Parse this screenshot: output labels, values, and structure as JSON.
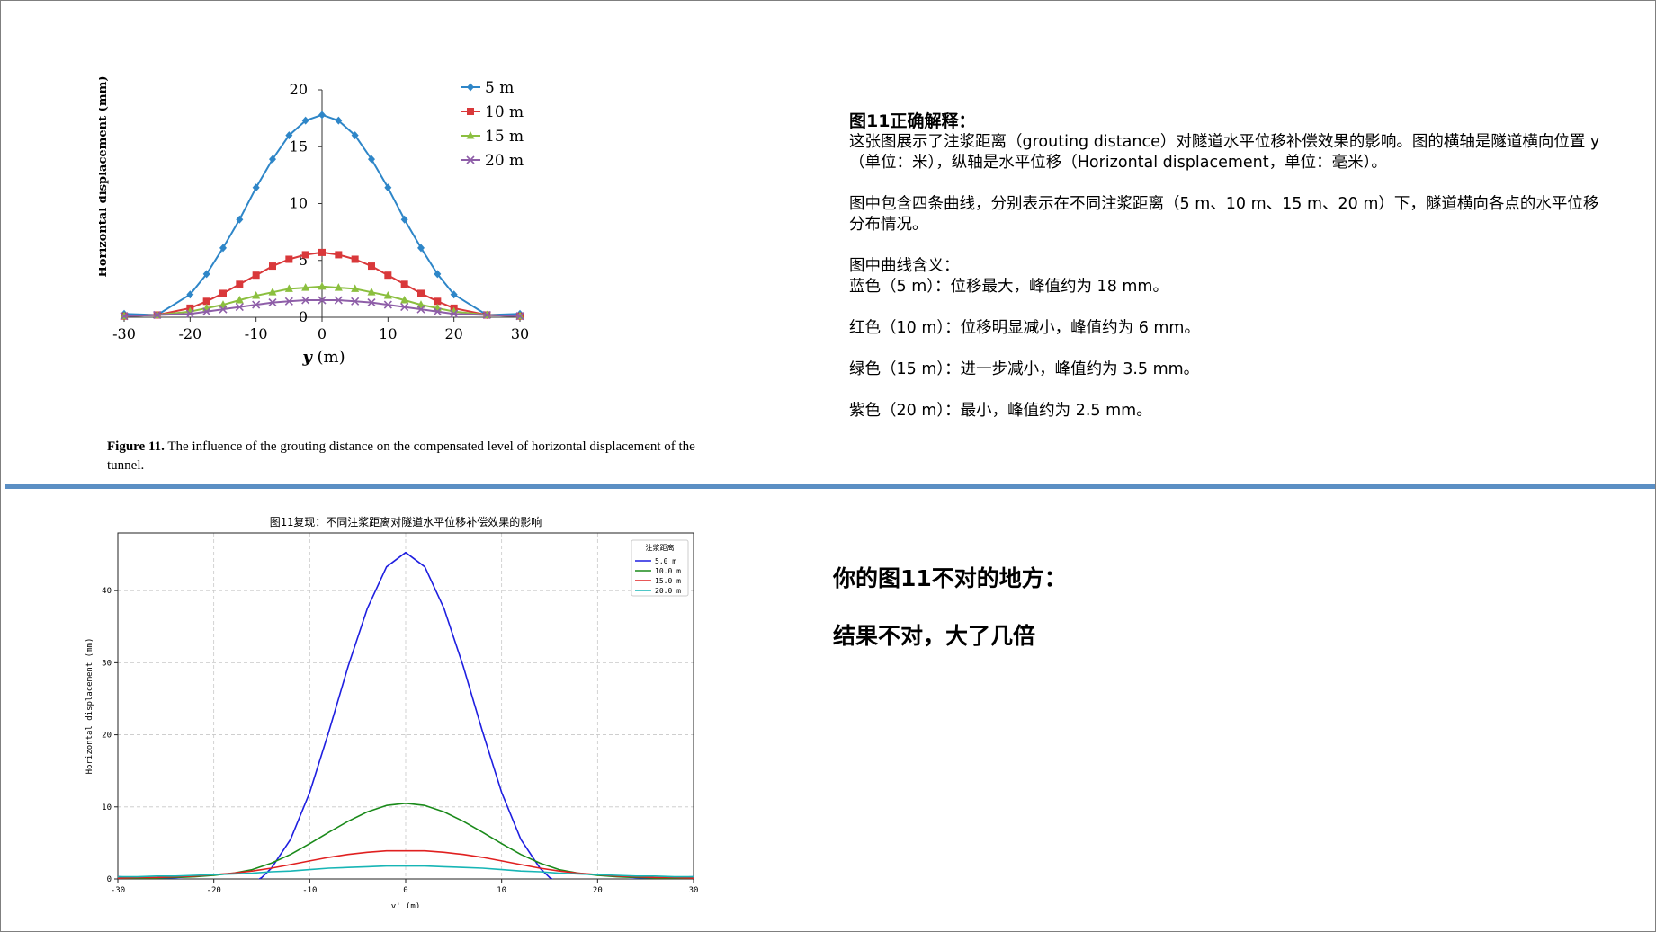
{
  "chart_data": [
    {
      "type": "line",
      "title": "",
      "xlabel": "y (m)",
      "ylabel": "Horizontal displacement (mm)",
      "xlim": [
        -30,
        30
      ],
      "ylim": [
        0,
        20
      ],
      "xticks": [
        -30,
        -20,
        -10,
        0,
        10,
        20,
        30
      ],
      "yticks": [
        0,
        5,
        10,
        15,
        20
      ],
      "grid": false,
      "legend_position": "top-right",
      "series": [
        {
          "name": "5 m",
          "color": "#2e86c8",
          "marker": "diamond",
          "x": [
            -30,
            -25,
            -20,
            -17.5,
            -15,
            -12.5,
            -10,
            -7.5,
            -5,
            -2.5,
            0,
            2.5,
            5,
            7.5,
            10,
            12.5,
            15,
            17.5,
            20,
            25,
            30
          ],
          "y": [
            0.3,
            0.2,
            2.0,
            3.8,
            6.1,
            8.6,
            11.4,
            13.9,
            16.0,
            17.3,
            17.8,
            17.3,
            16.0,
            13.9,
            11.4,
            8.6,
            6.1,
            3.8,
            2.0,
            0.2,
            0.3
          ]
        },
        {
          "name": "10 m",
          "color": "#d9383a",
          "marker": "square",
          "x": [
            -30,
            -25,
            -20,
            -17.5,
            -15,
            -12.5,
            -10,
            -7.5,
            -5,
            -2.5,
            0,
            2.5,
            5,
            7.5,
            10,
            12.5,
            15,
            17.5,
            20,
            25,
            30
          ],
          "y": [
            0.1,
            0.2,
            0.8,
            1.4,
            2.1,
            2.9,
            3.7,
            4.5,
            5.1,
            5.5,
            5.7,
            5.5,
            5.1,
            4.5,
            3.7,
            2.9,
            2.1,
            1.4,
            0.8,
            0.2,
            0.1
          ]
        },
        {
          "name": "15 m",
          "color": "#8bbf3f",
          "marker": "triangle",
          "x": [
            -30,
            -25,
            -20,
            -17.5,
            -15,
            -12.5,
            -10,
            -7.5,
            -5,
            -2.5,
            0,
            2.5,
            5,
            7.5,
            10,
            12.5,
            15,
            17.5,
            20,
            25,
            30
          ],
          "y": [
            0.1,
            0.2,
            0.5,
            0.8,
            1.1,
            1.5,
            1.9,
            2.2,
            2.5,
            2.6,
            2.7,
            2.6,
            2.5,
            2.2,
            1.9,
            1.5,
            1.1,
            0.8,
            0.5,
            0.2,
            0.1
          ]
        },
        {
          "name": "20 m",
          "color": "#8e5ea8",
          "marker": "x",
          "x": [
            -30,
            -25,
            -20,
            -17.5,
            -15,
            -12.5,
            -10,
            -7.5,
            -5,
            -2.5,
            0,
            2.5,
            5,
            7.5,
            10,
            12.5,
            15,
            17.5,
            20,
            25,
            30
          ],
          "y": [
            0.1,
            0.2,
            0.3,
            0.5,
            0.7,
            0.9,
            1.1,
            1.3,
            1.4,
            1.5,
            1.5,
            1.5,
            1.4,
            1.3,
            1.1,
            0.9,
            0.7,
            0.5,
            0.3,
            0.2,
            0.1
          ]
        }
      ]
    },
    {
      "type": "line",
      "title": "图11复现：不同注浆距离对隧道水平位移补偿效果的影响",
      "xlabel": "y' (m)",
      "ylabel": "Horizontal displacement (mm)",
      "xlim": [
        -30,
        30
      ],
      "ylim": [
        0,
        48
      ],
      "xticks": [
        -30,
        -20,
        -10,
        0,
        10,
        20,
        30
      ],
      "yticks": [
        0,
        10,
        20,
        30,
        40
      ],
      "grid": true,
      "legend_title": "注浆距离",
      "legend_position": "top-right",
      "series": [
        {
          "name": "5.0 m",
          "color": "#1f1fe0",
          "x": [
            -30,
            -28,
            -26,
            -24,
            -22,
            -20,
            -18,
            -16,
            -15,
            -14,
            -12,
            -10,
            -8,
            -6,
            -4,
            -2,
            0,
            2,
            4,
            6,
            8,
            10,
            12,
            14,
            15,
            16,
            18,
            20,
            22,
            24,
            26,
            28,
            30
          ],
          "y": [
            0.3,
            0.2,
            0.1,
            0,
            -0.2,
            -0.6,
            -1.0,
            -0.6,
            0.2,
            1.5,
            5.5,
            12.0,
            20.5,
            29.5,
            37.5,
            43.3,
            45.3,
            43.3,
            37.5,
            29.5,
            20.5,
            12.0,
            5.5,
            1.5,
            0.2,
            -0.6,
            -1.0,
            -0.6,
            -0.2,
            0,
            0.1,
            0.2,
            0.3
          ]
        },
        {
          "name": "10.0 m",
          "color": "#1a8a1a",
          "x": [
            -30,
            -28,
            -26,
            -24,
            -22,
            -20,
            -18,
            -16,
            -14,
            -12,
            -10,
            -8,
            -6,
            -4,
            -2,
            0,
            2,
            4,
            6,
            8,
            10,
            12,
            14,
            16,
            18,
            20,
            22,
            24,
            26,
            28,
            30
          ],
          "y": [
            0.1,
            0.1,
            0.1,
            0.2,
            0.3,
            0.5,
            0.8,
            1.3,
            2.2,
            3.4,
            4.9,
            6.5,
            8.0,
            9.3,
            10.2,
            10.5,
            10.2,
            9.3,
            8.0,
            6.5,
            4.9,
            3.4,
            2.2,
            1.3,
            0.8,
            0.5,
            0.3,
            0.2,
            0.1,
            0.1,
            0.1
          ]
        },
        {
          "name": "15.0 m",
          "color": "#e02020",
          "x": [
            -30,
            -28,
            -26,
            -24,
            -22,
            -20,
            -18,
            -16,
            -14,
            -12,
            -10,
            -8,
            -6,
            -4,
            -2,
            0,
            2,
            4,
            6,
            8,
            10,
            12,
            14,
            16,
            18,
            20,
            22,
            24,
            26,
            28,
            30
          ],
          "y": [
            0.1,
            0.2,
            0.2,
            0.3,
            0.4,
            0.6,
            0.8,
            1.1,
            1.5,
            2.0,
            2.5,
            3.0,
            3.4,
            3.7,
            3.9,
            3.9,
            3.9,
            3.7,
            3.4,
            3.0,
            2.5,
            2.0,
            1.5,
            1.1,
            0.8,
            0.6,
            0.4,
            0.3,
            0.2,
            0.2,
            0.1
          ]
        },
        {
          "name": "20.0 m",
          "color": "#17b5b5",
          "x": [
            -30,
            -28,
            -26,
            -24,
            -22,
            -20,
            -18,
            -16,
            -14,
            -12,
            -10,
            -8,
            -6,
            -4,
            -2,
            0,
            2,
            4,
            6,
            8,
            10,
            12,
            14,
            16,
            18,
            20,
            22,
            24,
            26,
            28,
            30
          ],
          "y": [
            0.3,
            0.3,
            0.4,
            0.4,
            0.5,
            0.6,
            0.7,
            0.8,
            1.0,
            1.1,
            1.3,
            1.5,
            1.6,
            1.7,
            1.8,
            1.8,
            1.8,
            1.7,
            1.6,
            1.5,
            1.3,
            1.1,
            1.0,
            0.8,
            0.7,
            0.6,
            0.5,
            0.4,
            0.4,
            0.3,
            0.3
          ]
        }
      ]
    }
  ],
  "top_caption": {
    "label": "Figure 11.",
    "text": " The influence of the grouting distance on the compensated level of horizontal displacement of the tunnel."
  },
  "explanation": {
    "title": "图11正确解释：",
    "para1": "这张图展示了注浆距离（grouting distance）对隧道水平位移补偿效果的影响。图的横轴是隧道横向位置 y（单位：米），纵轴是水平位移（Horizontal displacement，单位：毫米）。",
    "para2": "图中包含四条曲线，分别表示在不同注浆距离（5 m、10 m、15 m、20 m）下，隧道横向各点的水平位移分布情况。",
    "curves_title": "图中曲线含义：",
    "blue": "蓝色（5 m）：位移最大，峰值约为 18 mm。",
    "red": "红色（10 m）：位移明显减小，峰值约为 6 mm。",
    "green": "绿色（15 m）：进一步减小，峰值约为 3.5 mm。",
    "purple": "紫色（20 m）：最小，峰值约为 2.5 mm。"
  },
  "verdict": {
    "line1": "你的图11不对的地方：",
    "line2": "结果不对，大了几倍"
  }
}
